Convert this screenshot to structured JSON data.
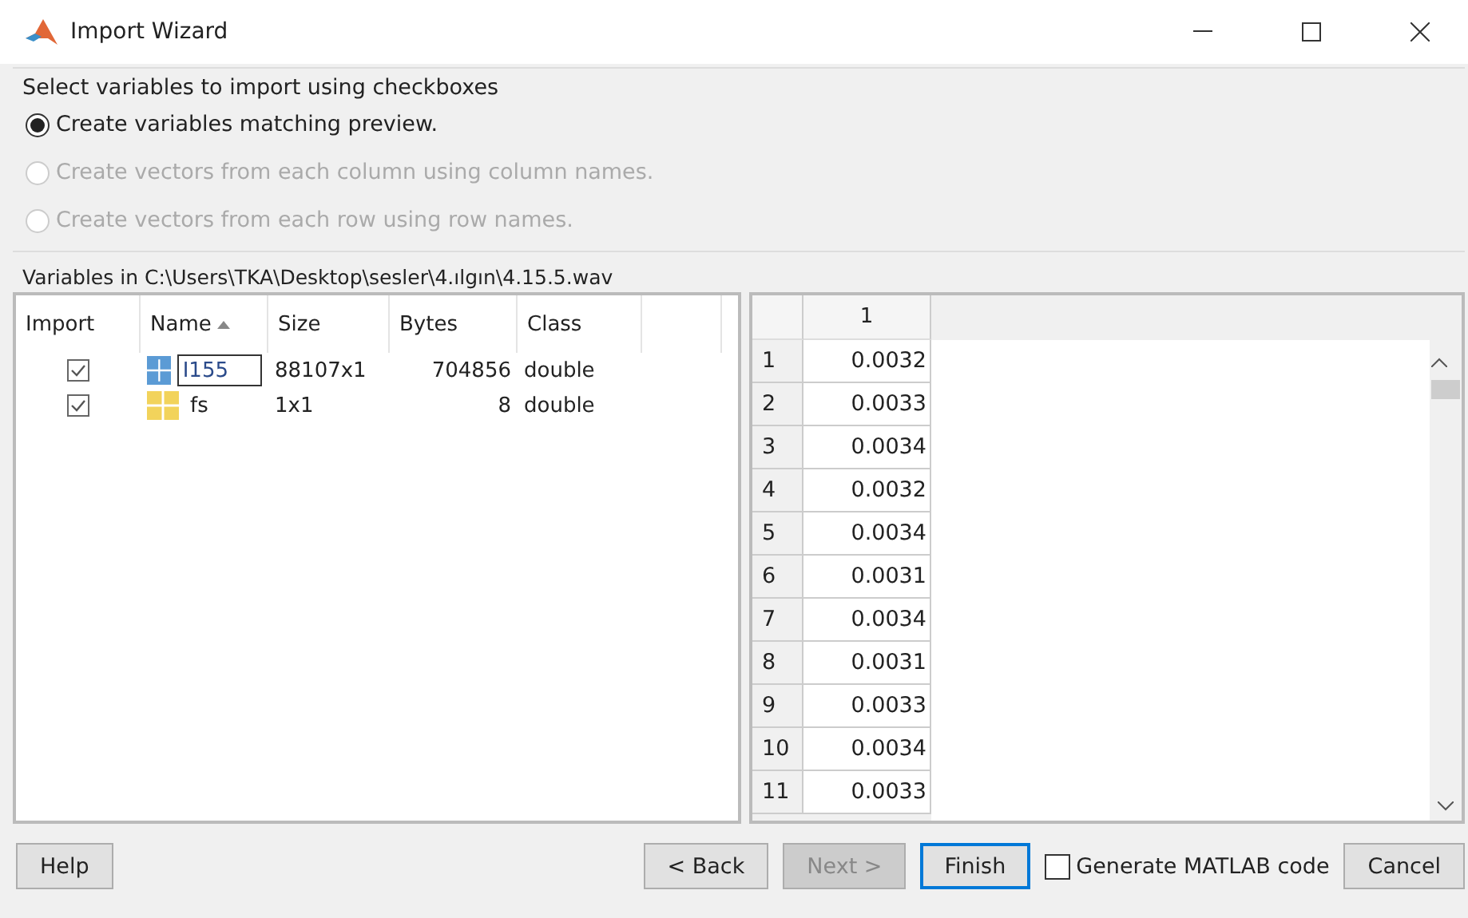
{
  "window": {
    "title": "Import Wizard"
  },
  "instruction": "Select variables to import using checkboxes",
  "options": [
    {
      "label": "Create variables matching preview.",
      "selected": true,
      "disabled": false
    },
    {
      "label": "Create vectors from each column using column names.",
      "selected": false,
      "disabled": true
    },
    {
      "label": "Create vectors from each row using row names.",
      "selected": false,
      "disabled": true
    }
  ],
  "variables_caption": "Variables in C:\\Users\\TKA\\Desktop\\sesler\\4.ılgın\\4.15.5.wav",
  "variables_table": {
    "columns": [
      {
        "label": "Import",
        "sorted": false
      },
      {
        "label": "Name",
        "sorted": true
      },
      {
        "label": "Size",
        "sorted": false
      },
      {
        "label": "Bytes",
        "sorted": false
      },
      {
        "label": "Class",
        "sorted": false
      }
    ],
    "rows": [
      {
        "checked": true,
        "name": "I155",
        "editing": true,
        "color": "#5b9bd5",
        "size": "88107x1",
        "bytes": "704856",
        "class": "double"
      },
      {
        "checked": true,
        "name": "fs",
        "editing": false,
        "color": "#f2d35b",
        "size": "1x1",
        "bytes": "8",
        "class": "double"
      }
    ]
  },
  "preview": {
    "column": "1",
    "rows": [
      {
        "index": "1",
        "value": "0.0032"
      },
      {
        "index": "2",
        "value": "0.0033"
      },
      {
        "index": "3",
        "value": "0.0034"
      },
      {
        "index": "4",
        "value": "0.0032"
      },
      {
        "index": "5",
        "value": "0.0034"
      },
      {
        "index": "6",
        "value": "0.0031"
      },
      {
        "index": "7",
        "value": "0.0034"
      },
      {
        "index": "8",
        "value": "0.0031"
      },
      {
        "index": "9",
        "value": "0.0033"
      },
      {
        "index": "10",
        "value": "0.0034"
      },
      {
        "index": "11",
        "value": "0.0033"
      }
    ]
  },
  "buttons": [
    {
      "label": "Help",
      "kind": "left",
      "disabled": false,
      "default": false
    },
    {
      "label": "< Back",
      "kind": "right",
      "disabled": false,
      "default": false
    },
    {
      "label": "Next >",
      "kind": "right",
      "disabled": true,
      "default": false
    },
    {
      "label": "Finish",
      "kind": "right",
      "disabled": false,
      "default": true
    },
    {
      "label": "Generate MATLAB code",
      "kind": "checkbox",
      "checked": false
    },
    {
      "label": "Cancel",
      "kind": "right",
      "disabled": false,
      "default": false
    }
  ]
}
